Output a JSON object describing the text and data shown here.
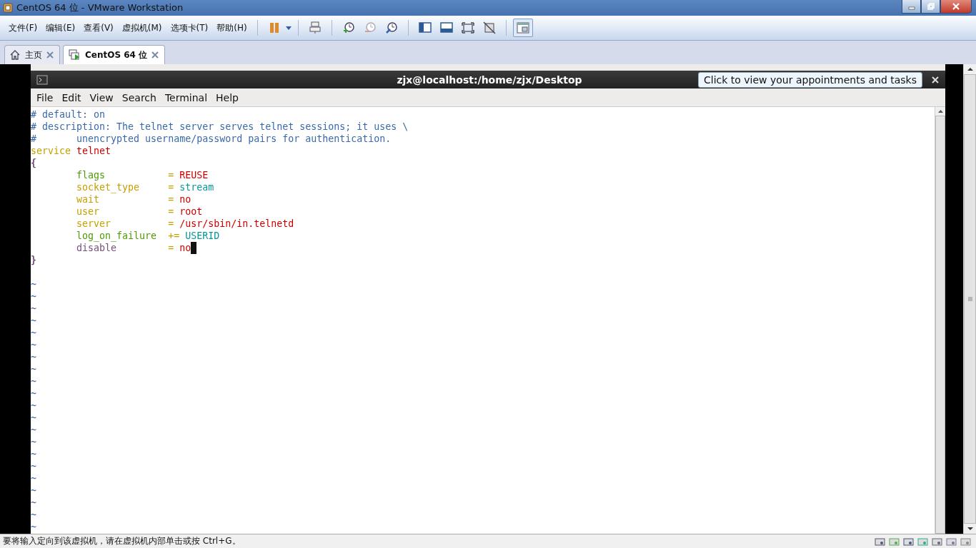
{
  "window": {
    "title": "CentOS 64 位 - VMware Workstation"
  },
  "menu": [
    "文件(F)",
    "编辑(E)",
    "查看(V)",
    "虚拟机(M)",
    "选项卡(T)",
    "帮助(H)"
  ],
  "tabs": [
    {
      "label": "主页",
      "selected": false,
      "kind": "home"
    },
    {
      "label": "CentOS 64 位",
      "selected": true,
      "kind": "vm"
    }
  ],
  "terminal": {
    "title": "zjx@localhost:/home/zjx/Desktop",
    "menu": [
      "File",
      "Edit",
      "View",
      "Search",
      "Terminal",
      "Help"
    ],
    "tooltip": "Click to view your appointments and tasks",
    "lines": [
      {
        "cursor": false,
        "tokens": [
          {
            "text": "# default: on",
            "color": "#3a6aa8"
          }
        ]
      },
      {
        "cursor": false,
        "tokens": [
          {
            "text": "# description: The telnet server serves telnet sessions; it uses \\",
            "color": "#3a6aa8"
          }
        ]
      },
      {
        "cursor": false,
        "tokens": [
          {
            "text": "#       unencrypted username/password pairs for authentication.",
            "color": "#3a6aa8"
          }
        ]
      },
      {
        "cursor": false,
        "tokens": [
          {
            "text": "service ",
            "color": "#c4a000"
          },
          {
            "text": "telnet",
            "color": "#cc0000"
          }
        ]
      },
      {
        "cursor": false,
        "tokens": [
          {
            "text": "{",
            "color": "#75507b"
          }
        ]
      },
      {
        "cursor": false,
        "tokens": [
          {
            "text": "        flags",
            "color": "#4e9a06"
          },
          {
            "text": "           = ",
            "color": "#c4a000"
          },
          {
            "text": "REUSE",
            "color": "#cc0000"
          }
        ]
      },
      {
        "cursor": false,
        "tokens": [
          {
            "text": "        socket_type",
            "color": "#c4a000"
          },
          {
            "text": "     = ",
            "color": "#c4a000"
          },
          {
            "text": "stream",
            "color": "#06989a"
          }
        ]
      },
      {
        "cursor": false,
        "tokens": [
          {
            "text": "        wait",
            "color": "#c4a000"
          },
          {
            "text": "            = ",
            "color": "#c4a000"
          },
          {
            "text": "no",
            "color": "#cc0000"
          }
        ]
      },
      {
        "cursor": false,
        "tokens": [
          {
            "text": "        user",
            "color": "#c4a000"
          },
          {
            "text": "            = ",
            "color": "#c4a000"
          },
          {
            "text": "root",
            "color": "#cc0000"
          }
        ]
      },
      {
        "cursor": false,
        "tokens": [
          {
            "text": "        server",
            "color": "#c4a000"
          },
          {
            "text": "          = ",
            "color": "#c4a000"
          },
          {
            "text": "/usr/sbin/in.telnetd",
            "color": "#cc0000"
          }
        ]
      },
      {
        "cursor": false,
        "tokens": [
          {
            "text": "        log_on_failure",
            "color": "#4e9a06"
          },
          {
            "text": "  += ",
            "color": "#c4a000"
          },
          {
            "text": "USERID",
            "color": "#06989a"
          }
        ]
      },
      {
        "cursor": true,
        "tokens": [
          {
            "text": "        disable",
            "color": "#75507b"
          },
          {
            "text": "         = ",
            "color": "#c4a000"
          },
          {
            "text": "no",
            "color": "#cc0000"
          }
        ]
      },
      {
        "cursor": false,
        "tokens": [
          {
            "text": "}",
            "color": "#75507b"
          }
        ]
      }
    ],
    "tildes": [
      "~",
      "~",
      "~",
      "~",
      "~",
      "~",
      "~",
      "~",
      "~",
      "~",
      "~",
      "~",
      "~",
      "~",
      "~",
      "~",
      "~",
      "~",
      "~",
      "~",
      "~"
    ]
  },
  "status_bar": {
    "text": "要将输入定向到该虚拟机，请在虚拟机内部单击或按 Ctrl+G。"
  }
}
